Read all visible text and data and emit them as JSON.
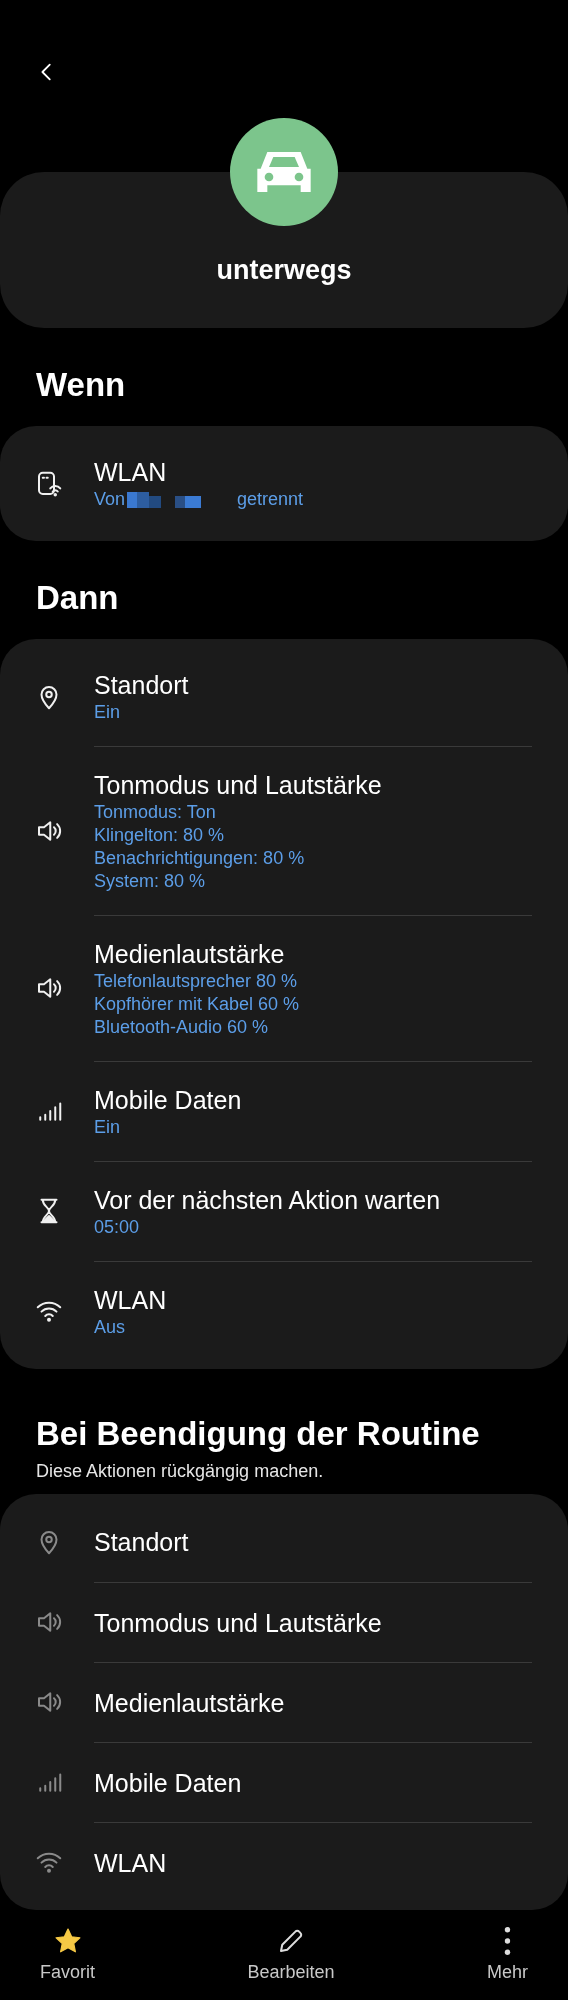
{
  "routine": {
    "name": "unterwegs"
  },
  "if_section": {
    "heading": "Wenn",
    "items": [
      {
        "kind": "wifi-device",
        "title": "WLAN",
        "detail_prefix": "Von",
        "detail_suffix": "getrennt"
      }
    ]
  },
  "then_section": {
    "heading": "Dann",
    "items": [
      {
        "kind": "location",
        "title": "Standort",
        "details": [
          "Ein"
        ]
      },
      {
        "kind": "sound",
        "title": "Tonmodus und Lautstärke",
        "details": [
          "Tonmodus: Ton",
          "Klingelton: 80 %",
          "Benachrichtigungen: 80 %",
          "System: 80 %"
        ]
      },
      {
        "kind": "sound",
        "title": "Medienlautstärke",
        "details": [
          "Telefonlautsprecher 80 %",
          "Kopfhörer mit Kabel 60 %",
          "Bluetooth-Audio 60 %"
        ]
      },
      {
        "kind": "signal",
        "title": "Mobile Daten",
        "details": [
          "Ein"
        ]
      },
      {
        "kind": "hourglass",
        "title": "Vor der nächsten Aktion warten",
        "details": [
          "05:00"
        ]
      },
      {
        "kind": "wifi",
        "title": "WLAN",
        "details": [
          "Aus"
        ]
      }
    ]
  },
  "end_section": {
    "heading": "Bei Beendigung der Routine",
    "subtitle": "Diese Aktionen rückgängig machen.",
    "items": [
      {
        "kind": "location",
        "title": "Standort"
      },
      {
        "kind": "sound",
        "title": "Tonmodus und Lautstärke"
      },
      {
        "kind": "sound",
        "title": "Medienlautstärke"
      },
      {
        "kind": "signal",
        "title": "Mobile Daten"
      },
      {
        "kind": "wifi",
        "title": "WLAN"
      }
    ]
  },
  "bottom_bar": [
    {
      "kind": "star",
      "label": "Favorit"
    },
    {
      "kind": "pencil",
      "label": "Bearbeiten"
    },
    {
      "kind": "more",
      "label": "Mehr"
    }
  ]
}
